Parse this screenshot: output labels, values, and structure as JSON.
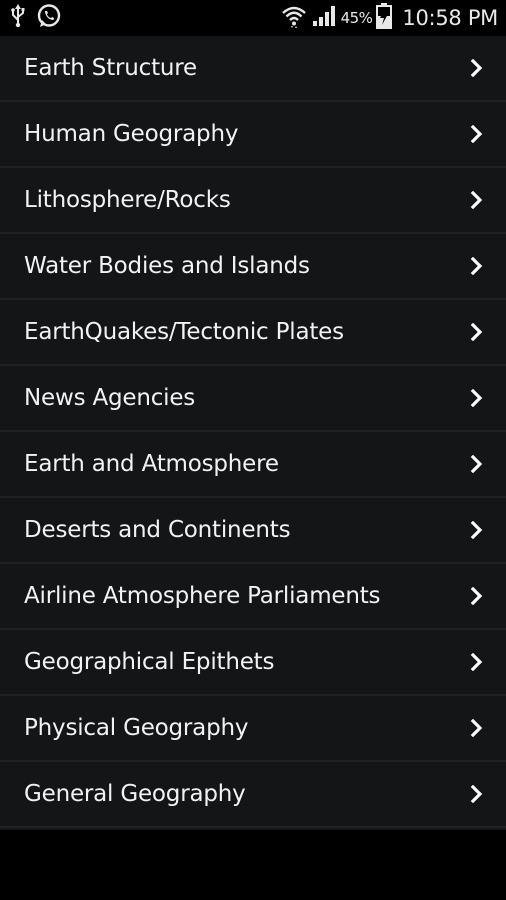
{
  "status_bar": {
    "icons_left": [
      "usb-icon",
      "whatsapp-icon"
    ],
    "icons_right": [
      "wifi-icon",
      "signal-icon",
      "battery-icon"
    ],
    "battery_percent": "45%",
    "time": "10:58 PM"
  },
  "menu": {
    "items": [
      {
        "label": "Earth Structure"
      },
      {
        "label": "Human Geography"
      },
      {
        "label": "Lithosphere/Rocks"
      },
      {
        "label": "Water Bodies and Islands"
      },
      {
        "label": "EarthQuakes/Tectonic Plates"
      },
      {
        "label": "News Agencies"
      },
      {
        "label": "Earth and Atmosphere"
      },
      {
        "label": "Deserts and Continents"
      },
      {
        "label": "Airline Atmosphere Parliaments"
      },
      {
        "label": "Geographical Epithets"
      },
      {
        "label": "Physical Geography"
      },
      {
        "label": "General Geography"
      }
    ],
    "chevron_icon": "chevron-right-icon"
  },
  "colors": {
    "background": "#000000",
    "list_background": "#131517",
    "divider": "#1f2123",
    "text": "#f2f2f2"
  }
}
